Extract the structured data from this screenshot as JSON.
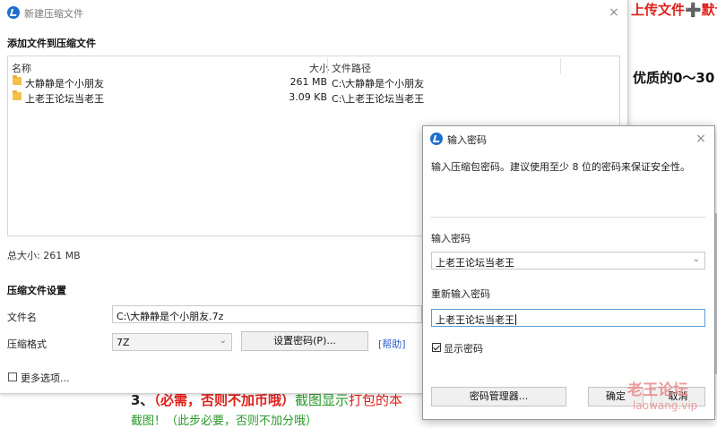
{
  "background": {
    "red_heading": "上传文件➕默认",
    "black_heading": "优质的0～30",
    "line1": {
      "num": "3、",
      "red": "（必需，否则不加币哦）",
      "green": "截图显示",
      "dark": "打包的本"
    },
    "line2": "截图！（此步必要，否则不加分哦）"
  },
  "watermark": {
    "line1": "老王论坛",
    "line2": "laowang.vip"
  },
  "main_window": {
    "title": "新建压缩文件",
    "add_files_heading": "添加文件到压缩文件",
    "file_list": {
      "columns": {
        "name": "名称",
        "size": "大小",
        "path": "文件路径"
      },
      "rows": [
        {
          "name": "大静静是个小朋友",
          "size": "261 MB",
          "path": "C:\\大静静是个小朋友"
        },
        {
          "name": "上老王论坛当老王",
          "size": "3.09 KB",
          "path": "C:\\上老王论坛当老王"
        }
      ]
    },
    "total_size": "总大小: 261 MB",
    "settings_heading": "压缩文件设置",
    "filename_label": "文件名",
    "filename_value": "C:\\大静静是个小朋友.7z",
    "format_label": "压缩格式",
    "format_value": "7Z",
    "set_password_button": "设置密码(P)...",
    "help_link": "[帮助]",
    "more_options_label": "更多选项..."
  },
  "password_dialog": {
    "title": "输入密码",
    "description": "输入压缩包密码。建议使用至少 8 位的密码来保证安全性。",
    "password_label": "输入密码",
    "password_value": "上老王论坛当老王",
    "reenter_label": "重新输入密码",
    "reenter_value": "上老王论坛当老王",
    "show_password_label": "显示密码",
    "show_password_checked": true,
    "password_manager_button": "密码管理器...",
    "ok_button": "确定",
    "cancel_button": "取消"
  },
  "icons": {
    "close": "×",
    "caret": "⌄"
  },
  "colors": {
    "accent": "#1f6fd0",
    "link": "#2b5fc9",
    "folder": "#f2c14a",
    "doc_red": "#e0201a",
    "doc_green": "#2a9a2a"
  }
}
